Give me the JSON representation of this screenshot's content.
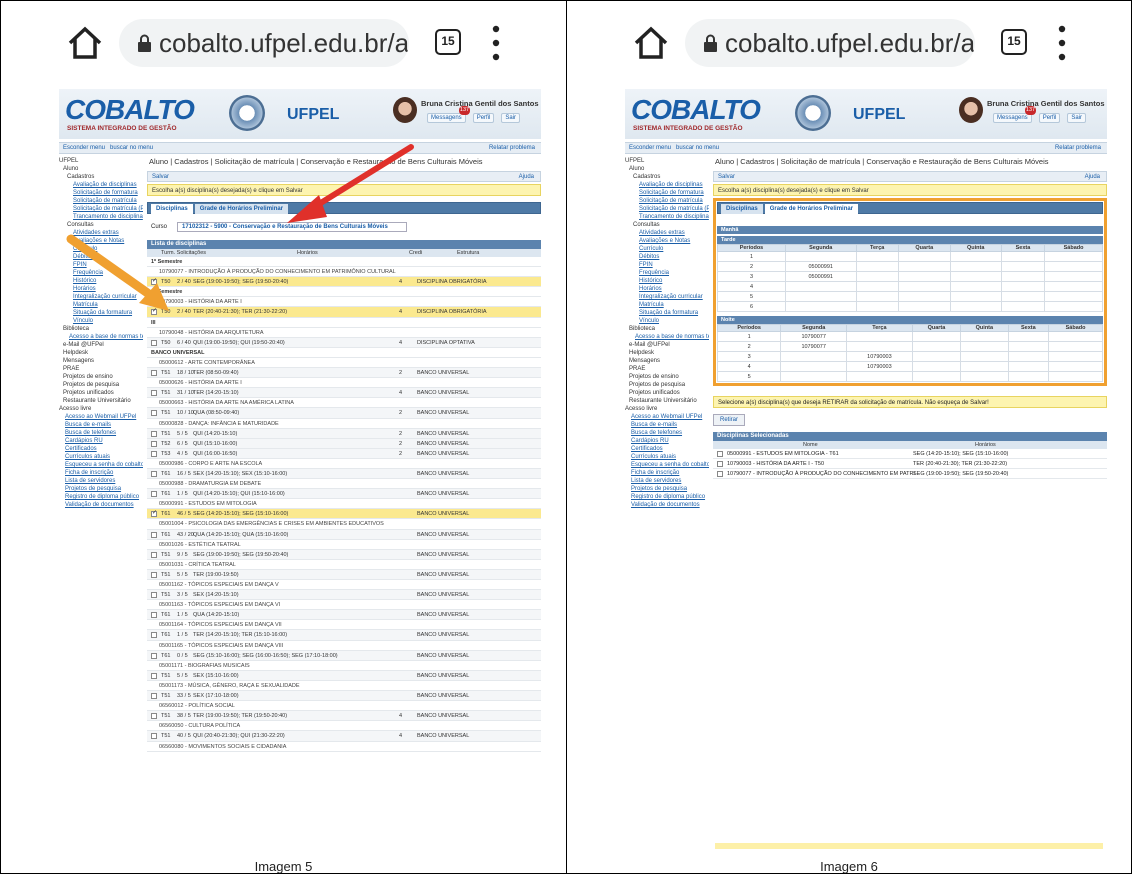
{
  "chrome": {
    "url": "cobalto.ufpel.edu.br/ac",
    "tab_count": "15"
  },
  "site": {
    "logo": "COBALTO",
    "logo_sub": "SISTEMA INTEGRADO DE GESTÃO",
    "institution": "UFPEL",
    "user_name": "Bruna Cristina Gentil dos Santos",
    "messages_label": "Messagens",
    "messages_badge": "137",
    "profile_label": "Perfil",
    "logout_label": "Sair",
    "hide_menu": "Esconder menu",
    "search_menu": "buscar no menu",
    "report_problem": "Relatar problema"
  },
  "sidebar": [
    {
      "t": "UFPEL",
      "l": 0,
      "link": false
    },
    {
      "t": "Aluno",
      "l": 4,
      "link": false
    },
    {
      "t": "Cadastros",
      "l": 8,
      "link": false
    },
    {
      "t": "Avaliação de disciplinas",
      "l": 14,
      "link": true
    },
    {
      "t": "Solicitação de formatura",
      "l": 14,
      "link": true
    },
    {
      "t": "Solicitação de matrícula",
      "l": 14,
      "link": true
    },
    {
      "t": "Solicitação de matrícula (Pós)",
      "l": 14,
      "link": true
    },
    {
      "t": "Trancamento de disciplina",
      "l": 14,
      "link": true
    },
    {
      "t": "Consultas",
      "l": 8,
      "link": false
    },
    {
      "t": "Atividades extras",
      "l": 14,
      "link": true
    },
    {
      "t": "Avaliações e Notas",
      "l": 14,
      "link": true
    },
    {
      "t": "Currículo",
      "l": 14,
      "link": true
    },
    {
      "t": "Débitos",
      "l": 14,
      "link": true
    },
    {
      "t": "FPIN",
      "l": 14,
      "link": true
    },
    {
      "t": "Frequência",
      "l": 14,
      "link": true
    },
    {
      "t": "Histórico",
      "l": 14,
      "link": true
    },
    {
      "t": "Horários",
      "l": 14,
      "link": true
    },
    {
      "t": "Integralização curricular",
      "l": 14,
      "link": true
    },
    {
      "t": "Matrícula",
      "l": 14,
      "link": true
    },
    {
      "t": "Situação da formatura",
      "l": 14,
      "link": true
    },
    {
      "t": "Vínculo",
      "l": 14,
      "link": true
    },
    {
      "t": "Biblioteca",
      "l": 4,
      "link": false
    },
    {
      "t": "Acesso a base de normas técnicas",
      "l": 10,
      "link": true
    },
    {
      "t": "e-Mail @UFPel",
      "l": 4,
      "link": false
    },
    {
      "t": "Helpdesk",
      "l": 4,
      "link": false
    },
    {
      "t": "Mensagens",
      "l": 4,
      "link": false
    },
    {
      "t": "PRAE",
      "l": 4,
      "link": false
    },
    {
      "t": "Projetos de ensino",
      "l": 4,
      "link": false
    },
    {
      "t": "Projetos de pesquisa",
      "l": 4,
      "link": false
    },
    {
      "t": "Projetos unificados",
      "l": 4,
      "link": false
    },
    {
      "t": "Restaurante Universitário",
      "l": 4,
      "link": false
    },
    {
      "t": "Acesso livre",
      "l": 0,
      "link": false
    },
    {
      "t": "Acesso ao Webmail UFPel",
      "l": 6,
      "link": true
    },
    {
      "t": "Busca de e-mails",
      "l": 6,
      "link": true
    },
    {
      "t": "Busca de telefones",
      "l": 6,
      "link": true
    },
    {
      "t": "Cardápios RU",
      "l": 6,
      "link": true
    },
    {
      "t": "Certificados",
      "l": 6,
      "link": true
    },
    {
      "t": "Currículos atuais",
      "l": 6,
      "link": true
    },
    {
      "t": "Esqueceu a senha do cobalto?",
      "l": 6,
      "link": true
    },
    {
      "t": "Ficha de inscrição",
      "l": 6,
      "link": true
    },
    {
      "t": "Lista de servidores",
      "l": 6,
      "link": true
    },
    {
      "t": "Projetos de pesquisa",
      "l": 6,
      "link": true
    },
    {
      "t": "Registro de diploma público",
      "l": 6,
      "link": true
    },
    {
      "t": "Validação de documentos",
      "l": 6,
      "link": true
    }
  ],
  "breadcrumb": "Aluno | Cadastros | Solicitação de matrícula | Conservação e Restauração de Bens Culturais Móveis",
  "toolbar": {
    "save": "Salvar",
    "help": "Ajuda"
  },
  "warning": "Escolha a(s) disciplina(s) desejada(s) e clique em Salvar",
  "tabs": {
    "disciplinas": "Disciplinas",
    "grade": "Grade de Horários Preliminar"
  },
  "curso": {
    "label": "Curso",
    "value": "17102312 - 5900 - Conservação e Restauração de Bens Culturais Móveis"
  },
  "lista": {
    "title": "Lista de disciplinas",
    "col_turma": "Turm. Solicitações",
    "col_horarios": "Horários",
    "col_cred": "Credi",
    "col_estrutura": "Estrutura"
  },
  "rows": [
    {
      "k": "sem",
      "t": "1º Semestre"
    },
    {
      "k": "disc",
      "t": "10790077 - INTRODUÇÃO À PRODUÇÃO DO CONHECIMENTO EM PATRIMÔNIO CULTURAL"
    },
    {
      "k": "turma",
      "sel": true,
      "tu": "T50",
      "v": "2 / 40",
      "h": "SEG (19:00-19:50); SEG (19:50-20:40)",
      "c": "4",
      "e": "DISCIPLINA OBRIGATÓRIA"
    },
    {
      "k": "sem",
      "t": "2º Semestre"
    },
    {
      "k": "disc",
      "t": "10790003 - HISTÓRIA DA ARTE I"
    },
    {
      "k": "turma",
      "sel": true,
      "tu": "T50",
      "v": "2 / 40",
      "h": "TER (20:40-21:30); TER (21:30-22:20)",
      "c": "4",
      "e": "DISCIPLINA OBRIGATÓRIA"
    },
    {
      "k": "sem",
      "t": "III"
    },
    {
      "k": "disc",
      "t": "10790048 - HISTÓRIA DA ARQUITETURA"
    },
    {
      "k": "turma",
      "tu": "T50",
      "v": "6 / 40",
      "h": "QUI (19:00-19:50); QUI (19:50-20:40)",
      "c": "4",
      "e": "DISCIPLINA OPTATIVA"
    },
    {
      "k": "sem",
      "t": "BANCO UNIVERSAL"
    },
    {
      "k": "disc",
      "t": "05000612 - ARTE CONTEMPORÂNEA"
    },
    {
      "k": "turma",
      "tu": "T51",
      "v": "18 / 10",
      "h": "TER (08:50-09:40)",
      "c": "2",
      "e": "BANCO UNIVERSAL"
    },
    {
      "k": "disc",
      "t": "05000626 - HISTÓRIA DA ARTE I"
    },
    {
      "k": "turma",
      "tu": "T51",
      "v": "31 / 10",
      "h": "TER (14:20-15:10)",
      "c": "4",
      "e": "BANCO UNIVERSAL"
    },
    {
      "k": "disc",
      "t": "05000663 - HISTÓRIA DA ARTE NA AMÉRICA LATINA"
    },
    {
      "k": "turma",
      "tu": "T51",
      "v": "10 / 10",
      "h": "QUA (08:50-09:40)",
      "c": "2",
      "e": "BANCO UNIVERSAL"
    },
    {
      "k": "disc",
      "t": "05000828 - DANÇA: INFÂNCIA E MATURIDADE"
    },
    {
      "k": "turma",
      "tu": "T51",
      "v": "5 / 5",
      "h": "QUI (14:20-15:10)",
      "c": "2",
      "e": "BANCO UNIVERSAL"
    },
    {
      "k": "turma",
      "tu": "T52",
      "v": "6 / 5",
      "h": "QUI (15:10-16:00)",
      "c": "2",
      "e": "BANCO UNIVERSAL"
    },
    {
      "k": "turma",
      "tu": "T53",
      "v": "4 / 5",
      "h": "QUI (16:00-16:50)",
      "c": "2",
      "e": "BANCO UNIVERSAL"
    },
    {
      "k": "disc",
      "t": "05000986 - CORPO E ARTE NA ESCOLA"
    },
    {
      "k": "turma",
      "tu": "T61",
      "v": "16 / 5",
      "h": "SEX (14:20-15:10); SEX (15:10-16:00)",
      "c": "",
      "e": "BANCO UNIVERSAL"
    },
    {
      "k": "disc",
      "t": "05000988 - DRAMATURGIA EM DEBATE"
    },
    {
      "k": "turma",
      "tu": "T61",
      "v": "1 / 5",
      "h": "QUI (14:20-15:10); QUI (15:10-16:00)",
      "c": "",
      "e": "BANCO UNIVERSAL"
    },
    {
      "k": "disc",
      "t": "05000991 - ESTUDOS EM MITOLOGIA"
    },
    {
      "k": "turma",
      "sel": true,
      "tu": "T61",
      "v": "46 / 5",
      "h": "SEG (14:20-15:10); SEG (15:10-16:00)",
      "c": "",
      "e": "BANCO UNIVERSAL"
    },
    {
      "k": "disc",
      "t": "05001004 - PSICOLOGIA DAS EMERGÊNCIAS E CRISES EM AMBIENTES EDUCATIVOS"
    },
    {
      "k": "turma",
      "tu": "T61",
      "v": "43 / 20",
      "h": "QUA (14:20-15:10); QUA (15:10-16:00)",
      "c": "",
      "e": "BANCO UNIVERSAL"
    },
    {
      "k": "disc",
      "t": "05001026 - ESTÉTICA TEATRAL"
    },
    {
      "k": "turma",
      "tu": "T51",
      "v": "9 / 5",
      "h": "SEG (19:00-19:50); SEG (19:50-20:40)",
      "c": "",
      "e": "BANCO UNIVERSAL"
    },
    {
      "k": "disc",
      "t": "05001031 - CRÍTICA TEATRAL"
    },
    {
      "k": "turma",
      "tu": "T51",
      "v": "5 / 5",
      "h": "TER (19:00-19:50)",
      "c": "",
      "e": "BANCO UNIVERSAL"
    },
    {
      "k": "disc",
      "t": "05001162 - TÓPICOS ESPECIAIS EM DANÇA V"
    },
    {
      "k": "turma",
      "tu": "T51",
      "v": "3 / 5",
      "h": "SEX (14:20-15:10)",
      "c": "",
      "e": "BANCO UNIVERSAL"
    },
    {
      "k": "disc",
      "t": "05001163 - TÓPICOS ESPECIAIS EM DANÇA VI"
    },
    {
      "k": "turma",
      "tu": "T61",
      "v": "1 / 5",
      "h": "QUA (14:20-15:10)",
      "c": "",
      "e": "BANCO UNIVERSAL"
    },
    {
      "k": "disc",
      "t": "05001164 - TÓPICOS ESPECIAIS EM DANÇA VII"
    },
    {
      "k": "turma",
      "tu": "T61",
      "v": "1 / 5",
      "h": "TER (14:20-15:10); TER (15:10-16:00)",
      "c": "",
      "e": "BANCO UNIVERSAL"
    },
    {
      "k": "disc",
      "t": "05001165 - TÓPICOS ESPECIAIS EM DANÇA VIII"
    },
    {
      "k": "turma",
      "tu": "T61",
      "v": "0 / 5",
      "h": "SEG (15:10-16:00); SEG (16:00-16:50); SEG (17:10-18:00)",
      "c": "",
      "e": "BANCO UNIVERSAL"
    },
    {
      "k": "disc",
      "t": "05001171 - BIOGRAFIAS MUSICAIS"
    },
    {
      "k": "turma",
      "tu": "T51",
      "v": "5 / 5",
      "h": "SEX (15:10-16:00)",
      "c": "",
      "e": "BANCO UNIVERSAL"
    },
    {
      "k": "disc",
      "t": "05001173 - MÚSICA, GÊNERO, RAÇA E SEXUALIDADE"
    },
    {
      "k": "turma",
      "tu": "T51",
      "v": "33 / 5",
      "h": "SEX (17:10-18:00)",
      "c": "",
      "e": "BANCO UNIVERSAL"
    },
    {
      "k": "disc",
      "t": "06560012 - POLÍTICA SOCIAL"
    },
    {
      "k": "turma",
      "tu": "T51",
      "v": "38 / 5",
      "h": "TER (19:00-19:50); TER (19:50-20:40)",
      "c": "4",
      "e": "BANCO UNIVERSAL"
    },
    {
      "k": "disc",
      "t": "06560050 - CULTURA POLÍTICA"
    },
    {
      "k": "turma",
      "tu": "T51",
      "v": "40 / 5",
      "h": "QUI (20:40-21:30); QUI (21:30-22:20)",
      "c": "4",
      "e": "BANCO UNIVERSAL"
    },
    {
      "k": "disc",
      "t": "06560080 - MOVIMENTOS SOCIAIS E CIDADANIA"
    }
  ],
  "grade": {
    "manha": "Manhã",
    "tarde": "Tarde",
    "noite": "Noite",
    "headers": [
      "Períodos",
      "Segunda",
      "Terça",
      "Quarta",
      "Quinta",
      "Sexta",
      "Sábado"
    ],
    "tarde_rows": [
      [
        "1",
        "",
        "",
        "",
        "",
        "",
        ""
      ],
      [
        "2",
        "05000991",
        "",
        "",
        "",
        "",
        ""
      ],
      [
        "3",
        "05000991",
        "",
        "",
        "",
        "",
        ""
      ],
      [
        "4",
        "",
        "",
        "",
        "",
        "",
        ""
      ],
      [
        "5",
        "",
        "",
        "",
        "",
        "",
        ""
      ],
      [
        "6",
        "",
        "",
        "",
        "",
        "",
        ""
      ]
    ],
    "noite_rows": [
      [
        "1",
        "10790077",
        "",
        "",
        "",
        "",
        ""
      ],
      [
        "2",
        "10790077",
        "",
        "",
        "",
        "",
        ""
      ],
      [
        "3",
        "",
        "10790003",
        "",
        "",
        "",
        ""
      ],
      [
        "4",
        "",
        "10790003",
        "",
        "",
        "",
        ""
      ],
      [
        "5",
        "",
        "",
        "",
        "",
        "",
        ""
      ]
    ]
  },
  "retirar": {
    "info": "Selecione a(s) disciplina(s) que deseja RETIRAR da solicitação de matrícula. Não esqueça de Salvar!",
    "button": "Retirar",
    "title": "Disciplinas Selecionadas",
    "col_nome": "Nome",
    "col_horarios": "Horários",
    "items": [
      {
        "nome": "05000991 - ESTUDOS EM MITOLOGIA - T61",
        "h": "SEG (14:20-15:10); SEG (15:10-16:00)"
      },
      {
        "nome": "10790003 - HISTÓRIA DA ARTE I - T50",
        "h": "TER (20:40-21:30); TER (21:30-22:20)"
      },
      {
        "nome": "10790077 - INTRODUÇÃO À PRODUÇÃO DO CONHECIMENTO EM PATRI",
        "h": "SEG (19:00-19:50); SEG (19:50-20:40)"
      }
    ]
  },
  "captions": {
    "p1": "Imagem 5",
    "p2": "Imagem 6"
  },
  "colors": {
    "arrow_red": "#e0302a",
    "arrow_orange": "#f0a030",
    "highlight": "#fbe98f",
    "brand": "#1a5ea8"
  }
}
